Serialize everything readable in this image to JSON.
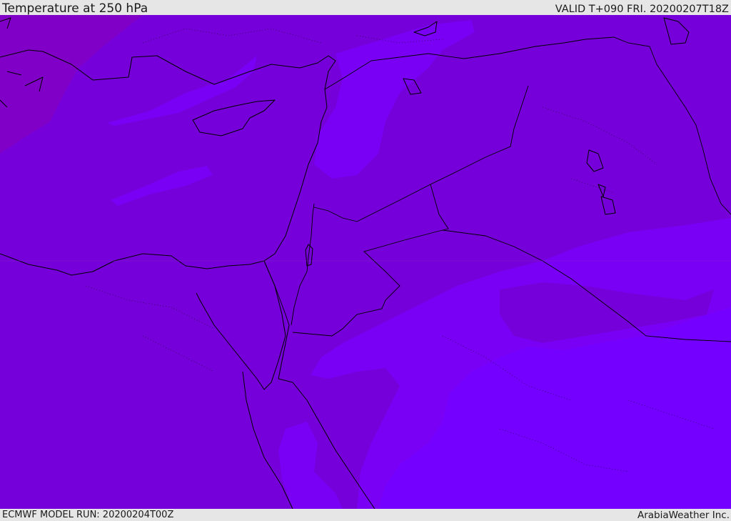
{
  "header": {
    "title": "Temperature at 250 hPa",
    "valid_time": "VALID T+090 FRI. 20200207T18Z"
  },
  "footer": {
    "model_run": "ECMWF MODEL RUN: 20200204T00Z",
    "credit": "ArabiaWeather Inc."
  },
  "map": {
    "colors": {
      "base_field": "#7600d9",
      "warmer_band": "#8100c8",
      "cold_band": "#7a00f5",
      "coldest_band": "#7400ff",
      "coastline": "#000000"
    }
  }
}
